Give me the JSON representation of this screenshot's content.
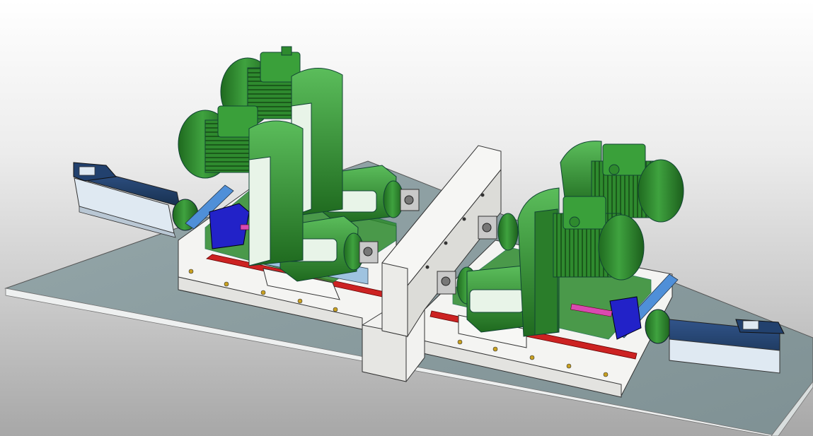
{
  "scene": {
    "kind": "cad-render",
    "colors": {
      "background_top": "#ffffff",
      "background_bottom": "#a7a7a7",
      "floor_plate": "#8c9ea1",
      "floor_edge": "#eef0f0",
      "machine_base": "#f4f4f2",
      "motor_green": "#2f8f2f",
      "motor_green_dark": "#1f6a1f",
      "motor_green_light": "#57b657",
      "cover_blue": "#4f8fd8",
      "block_blue": "#2222c8",
      "rail_red": "#cc2222",
      "servo_navy": "#1f3b66",
      "servo_light": "#dfe9f2",
      "screw_pink": "#d94ab0"
    },
    "icons": [
      "gear-motor-icon",
      "servo-motor-icon",
      "spindle-head-icon",
      "ball-screw-icon"
    ]
  }
}
